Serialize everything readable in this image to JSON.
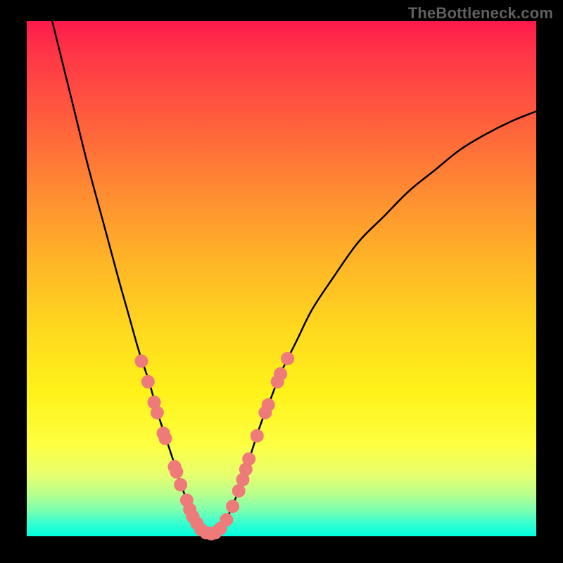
{
  "watermark": "TheBottleneck.com",
  "chart_data": {
    "type": "line",
    "title": "",
    "xlabel": "",
    "ylabel": "",
    "xlim": [
      0,
      100
    ],
    "ylim": [
      0,
      100
    ],
    "grid": false,
    "legend": false,
    "annotations": [],
    "series": [
      {
        "name": "curve",
        "style": "line",
        "color": "#000000",
        "points": [
          {
            "x": 5,
            "y": 100
          },
          {
            "x": 7,
            "y": 92
          },
          {
            "x": 9,
            "y": 84
          },
          {
            "x": 12,
            "y": 72
          },
          {
            "x": 15,
            "y": 61
          },
          {
            "x": 18,
            "y": 50
          },
          {
            "x": 20,
            "y": 43
          },
          {
            "x": 22,
            "y": 36
          },
          {
            "x": 24,
            "y": 30
          },
          {
            "x": 26,
            "y": 23
          },
          {
            "x": 28,
            "y": 17
          },
          {
            "x": 30,
            "y": 11
          },
          {
            "x": 31,
            "y": 8
          },
          {
            "x": 32,
            "y": 5
          },
          {
            "x": 33,
            "y": 3
          },
          {
            "x": 34,
            "y": 1.5
          },
          {
            "x": 35,
            "y": 0.8
          },
          {
            "x": 36,
            "y": 0.5
          },
          {
            "x": 37,
            "y": 0.8
          },
          {
            "x": 38,
            "y": 1.5
          },
          {
            "x": 39,
            "y": 3
          },
          {
            "x": 40,
            "y": 5
          },
          {
            "x": 42,
            "y": 10
          },
          {
            "x": 44,
            "y": 16
          },
          {
            "x": 46,
            "y": 22
          },
          {
            "x": 48,
            "y": 27
          },
          {
            "x": 50,
            "y": 32
          },
          {
            "x": 53,
            "y": 38
          },
          {
            "x": 56,
            "y": 44
          },
          {
            "x": 60,
            "y": 50
          },
          {
            "x": 65,
            "y": 57
          },
          {
            "x": 70,
            "y": 62
          },
          {
            "x": 75,
            "y": 67
          },
          {
            "x": 80,
            "y": 71
          },
          {
            "x": 85,
            "y": 75
          },
          {
            "x": 90,
            "y": 78
          },
          {
            "x": 95,
            "y": 80.5
          },
          {
            "x": 100,
            "y": 82.5
          }
        ]
      },
      {
        "name": "points-left",
        "style": "scatter",
        "color": "#ee7a7a",
        "points": [
          {
            "x": 22.5,
            "y": 34
          },
          {
            "x": 23.8,
            "y": 30
          },
          {
            "x": 25.0,
            "y": 26
          },
          {
            "x": 25.6,
            "y": 24
          },
          {
            "x": 26.8,
            "y": 20
          },
          {
            "x": 27.2,
            "y": 19
          },
          {
            "x": 29.0,
            "y": 13.5
          },
          {
            "x": 29.4,
            "y": 12.5
          },
          {
            "x": 30.2,
            "y": 10
          },
          {
            "x": 31.4,
            "y": 7
          },
          {
            "x": 32.0,
            "y": 5.2
          },
          {
            "x": 32.6,
            "y": 3.8
          },
          {
            "x": 33.4,
            "y": 2.5
          },
          {
            "x": 34.2,
            "y": 1.3
          },
          {
            "x": 35.2,
            "y": 0.7
          },
          {
            "x": 36.2,
            "y": 0.5
          },
          {
            "x": 37.0,
            "y": 0.7
          }
        ]
      },
      {
        "name": "points-right",
        "style": "scatter",
        "color": "#ee7a7a",
        "points": [
          {
            "x": 38.0,
            "y": 1.5
          },
          {
            "x": 39.2,
            "y": 3.2
          },
          {
            "x": 40.4,
            "y": 5.8
          },
          {
            "x": 41.6,
            "y": 8.8
          },
          {
            "x": 42.4,
            "y": 11
          },
          {
            "x": 43.0,
            "y": 13
          },
          {
            "x": 43.6,
            "y": 15
          },
          {
            "x": 45.2,
            "y": 19.5
          },
          {
            "x": 46.8,
            "y": 24
          },
          {
            "x": 47.4,
            "y": 25.5
          },
          {
            "x": 49.2,
            "y": 30
          },
          {
            "x": 49.8,
            "y": 31.5
          },
          {
            "x": 51.2,
            "y": 34.5
          }
        ]
      }
    ]
  }
}
